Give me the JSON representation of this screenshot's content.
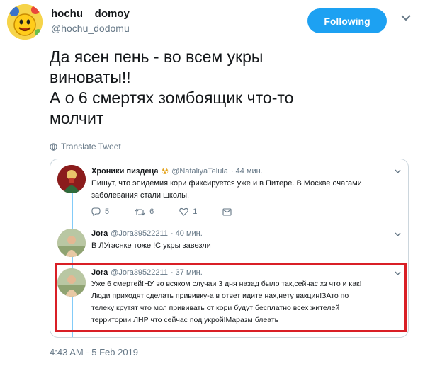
{
  "author": {
    "display_name": "hochu _ domoy",
    "username": "@hochu_dodomu",
    "avatar_icon": "smiley-flower-avatar"
  },
  "follow_button": {
    "label": "Following",
    "color": "#1da1f2"
  },
  "tweet": {
    "text": "Да  ясен пень - во всем  укры\nвиноваты!!\nА о 6 смертях зомбоящик что-то\nмолчит",
    "translate_label": "Translate Tweet",
    "timestamp": "4:43 AM - 5 Feb 2019"
  },
  "quoted_thread": [
    {
      "name": "Хроники пиздеца",
      "emoji": "☢",
      "handle": "@NataliyaTelula",
      "time": "· 44 мин.",
      "text_lines": [
        "Пишут, что эпидемия кори фиксируется уже и в Питере. В Москве очагами",
        "заболевания стали школы."
      ],
      "actions": {
        "replies": "5",
        "retweets": "6",
        "likes": "1"
      }
    },
    {
      "name": "Jora",
      "handle": "@Jora39522211",
      "time": "· 40 мин.",
      "text_lines": [
        "В ЛУгаснке тоже !С укры завезли"
      ]
    },
    {
      "name": "Jora",
      "handle": "@Jora39522211",
      "time": "· 37 мин.",
      "text_lines": [
        "Уже 6 смертей!НУ во всяком случаи 3 дня назад было так,сейчас хз что и как!",
        "Люди приходят сделать прививку-а в ответ идите нах,нету вакцин!ЗАто по",
        "телеку крутят что мол прививать от кори будут бесплатно всех жителей",
        "территории ЛНР что сейчас под укрой!Маразм блеать"
      ]
    }
  ],
  "colors": {
    "accent": "#1da1f2",
    "highlight": "#d91f26",
    "muted": "#657786"
  }
}
